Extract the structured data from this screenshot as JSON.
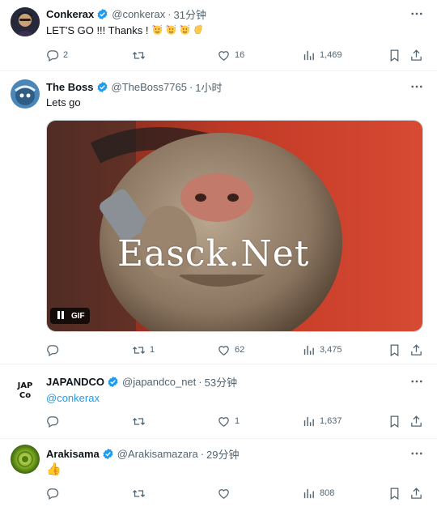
{
  "tweets": [
    {
      "name": "Conkerax",
      "handle": "@conkerax",
      "dot": "·",
      "time": "31分钟",
      "text": "LET'S GO !!! Thanks !",
      "emojis": [
        "partying-face-emoji",
        "partying-face-emoji",
        "partying-face-emoji",
        "clapping-hands-emoji"
      ],
      "stats": {
        "replies": "2",
        "retweets": "",
        "likes": "16",
        "views": "1,469"
      }
    },
    {
      "name": "The Boss",
      "handle": "@TheBoss7765",
      "dot": "·",
      "time": "1小时",
      "text": "Lets go",
      "media": {
        "type": "gif",
        "label": "GIF",
        "watermark": "Easck.Net"
      },
      "stats": {
        "replies": "",
        "retweets": "1",
        "likes": "62",
        "views": "3,475"
      }
    },
    {
      "name": "JAPANDCO",
      "handle": "@japandco_net",
      "dot": "·",
      "time": "53分钟",
      "text": "@conkerax",
      "avatar_text": "JAP Co",
      "stats": {
        "replies": "",
        "retweets": "",
        "likes": "1",
        "views": "1,637"
      }
    },
    {
      "name": "Arakisama",
      "handle": "@Arakisamazara",
      "dot": "·",
      "time": "29分钟",
      "text": "👍",
      "stats": {
        "replies": "",
        "retweets": "",
        "likes": "",
        "views": "808"
      }
    }
  ],
  "colors": {
    "accent": "#1d9bf0",
    "secondary_text": "#536471",
    "divider": "#eff3f4"
  }
}
